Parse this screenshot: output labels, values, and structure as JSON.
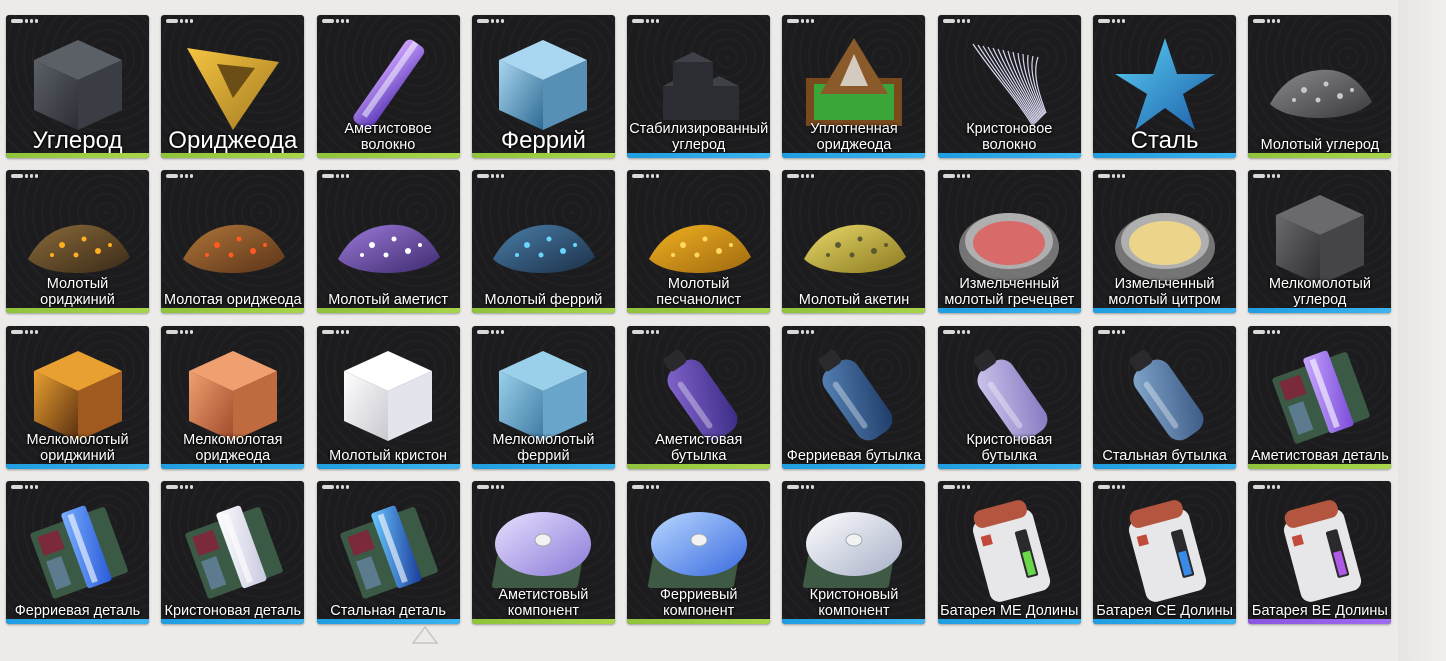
{
  "colors": {
    "green": "#9acd3f",
    "blue": "#2aa8ea",
    "purple": "#9560e8",
    "card_bg": "#1c1c1e",
    "page_bg": "#ecebe9"
  },
  "items": [
    {
      "label": "Углерод",
      "rarity": "green",
      "icon": "carbon-cube-icon",
      "size": "big"
    },
    {
      "label": "Ориджеода",
      "rarity": "green",
      "icon": "originium-crystal-icon",
      "size": "big"
    },
    {
      "label": "Аметистовое волокно",
      "rarity": "green",
      "icon": "amethyst-fiber-icon",
      "size": "normal"
    },
    {
      "label": "Феррий",
      "rarity": "green",
      "icon": "ferrium-cube-icon",
      "size": "big"
    },
    {
      "label": "Стабилизированный углерод",
      "rarity": "blue",
      "icon": "stabilized-carbon-icon",
      "size": "normal"
    },
    {
      "label": "Уплотненная ориджеода",
      "rarity": "blue",
      "icon": "dense-originium-icon",
      "size": "normal"
    },
    {
      "label": "Кристоновое волокно",
      "rarity": "blue",
      "icon": "kriston-fiber-icon",
      "size": "normal"
    },
    {
      "label": "Сталь",
      "rarity": "blue",
      "icon": "steel-star-icon",
      "size": "big"
    },
    {
      "label": "Молотый углерод",
      "rarity": "green",
      "icon": "ground-carbon-icon",
      "size": "normal"
    },
    {
      "label": "Молотый ориджиний",
      "rarity": "green",
      "icon": "ground-origin-pile-icon",
      "size": "normal"
    },
    {
      "label": "Молотая ориджеода",
      "rarity": "green",
      "icon": "ground-originium-pile-icon",
      "size": "normal"
    },
    {
      "label": "Молотый аметист",
      "rarity": "green",
      "icon": "ground-amethyst-pile-icon",
      "size": "normal"
    },
    {
      "label": "Молотый феррий",
      "rarity": "green",
      "icon": "ground-ferrium-pile-icon",
      "size": "normal"
    },
    {
      "label": "Молотый песчанолист",
      "rarity": "green",
      "icon": "ground-sandleaf-pile-icon",
      "size": "normal"
    },
    {
      "label": "Молотый акетин",
      "rarity": "green",
      "icon": "ground-aketine-pile-icon",
      "size": "normal"
    },
    {
      "label": "Измельченный молотый гречецвет",
      "rarity": "blue",
      "icon": "buckwheat-dish-icon",
      "size": "normal"
    },
    {
      "label": "Измельченный молотый цитром",
      "rarity": "blue",
      "icon": "citrome-dish-icon",
      "size": "normal"
    },
    {
      "label": "Мелкомолотый углерод",
      "rarity": "blue",
      "icon": "fine-carbon-cube-icon",
      "size": "normal"
    },
    {
      "label": "Мелкомолотый ориджиний",
      "rarity": "blue",
      "icon": "fine-origin-cube-icon",
      "size": "normal"
    },
    {
      "label": "Мелкомолотая ориджеода",
      "rarity": "blue",
      "icon": "fine-originium-cube-icon",
      "size": "normal"
    },
    {
      "label": "Молотый кристон",
      "rarity": "blue",
      "icon": "kriston-cube-icon",
      "size": "normal"
    },
    {
      "label": "Мелкомолотый феррий",
      "rarity": "blue",
      "icon": "fine-ferrium-cube-icon",
      "size": "normal"
    },
    {
      "label": "Аметистовая бутылка",
      "rarity": "green",
      "icon": "amethyst-bottle-icon",
      "size": "normal"
    },
    {
      "label": "Ферриевая бутылка",
      "rarity": "blue",
      "icon": "ferrium-bottle-icon",
      "size": "normal"
    },
    {
      "label": "Кристоновая бутылка",
      "rarity": "blue",
      "icon": "kriston-bottle-icon",
      "size": "normal"
    },
    {
      "label": "Стальная бутылка",
      "rarity": "blue",
      "icon": "steel-bottle-icon",
      "size": "normal"
    },
    {
      "label": "Аметистовая деталь",
      "rarity": "green",
      "icon": "amethyst-part-icon",
      "size": "normal"
    },
    {
      "label": "Ферриевая деталь",
      "rarity": "blue",
      "icon": "ferrium-part-icon",
      "size": "normal"
    },
    {
      "label": "Кристоновая деталь",
      "rarity": "blue",
      "icon": "kriston-part-icon",
      "size": "normal"
    },
    {
      "label": "Стальная деталь",
      "rarity": "blue",
      "icon": "steel-part-icon",
      "size": "normal"
    },
    {
      "label": "Аметистовый компонент",
      "rarity": "green",
      "icon": "amethyst-component-icon",
      "size": "normal"
    },
    {
      "label": "Ферриевый компонент",
      "rarity": "green",
      "icon": "ferrium-component-icon",
      "size": "normal"
    },
    {
      "label": "Кристоновый компонент",
      "rarity": "blue",
      "icon": "kriston-component-icon",
      "size": "normal"
    },
    {
      "label": "Батарея МЕ Долины",
      "rarity": "blue",
      "icon": "battery-01-icon",
      "size": "normal"
    },
    {
      "label": "Батарея СЕ Долины",
      "rarity": "blue",
      "icon": "battery-02-icon",
      "size": "normal"
    },
    {
      "label": "Батарея ВЕ Долины",
      "rarity": "purple",
      "icon": "battery-03-icon",
      "size": "normal"
    }
  ]
}
